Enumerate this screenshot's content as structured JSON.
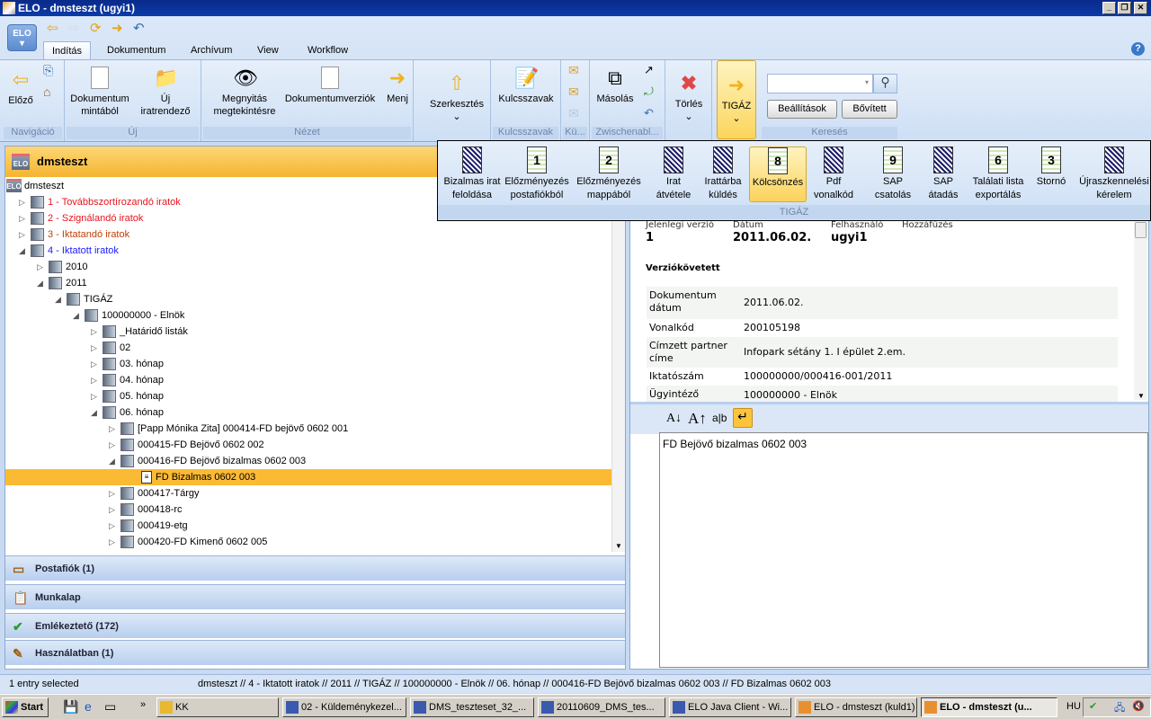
{
  "window": {
    "title": "ELO - dmsteszt (ugyi1)"
  },
  "app_menu": {
    "label": "ELO"
  },
  "tabs": [
    "Indítás",
    "Dokumentum",
    "Archívum",
    "View",
    "Workflow"
  ],
  "ribbon": {
    "groups": {
      "nav": "Navigáció",
      "new": "Új",
      "view": "Nézet",
      "keywords": "Kulcsszavak",
      "send": "Kü...",
      "clipboard": "Zwischenabl...",
      "search": "Keresés"
    },
    "buttons": {
      "prev": "Előző",
      "doc_template_1": "Dokumentum",
      "doc_template_2": "mintából",
      "new_folder_1": "Új",
      "new_folder_2": "iratrendező",
      "open_view_1": "Megnyitás",
      "open_view_2": "megtekintésre",
      "doc_versions": "Dokumentumverziók",
      "go": "Menj",
      "edit": "Szerkesztés",
      "keywords": "Kulcsszavak",
      "copy": "Másolás",
      "delete": "Törlés",
      "tigaz": "TIGÁZ"
    },
    "search": {
      "value": "",
      "settings": "Beállítások",
      "advanced": "Bővített"
    }
  },
  "tigaz_popup": {
    "group": "TIGÁZ",
    "items": [
      {
        "l1": "Bizalmas irat",
        "l2": "feloldása",
        "badge": ""
      },
      {
        "l1": "Előzményezés",
        "l2": "postafiókból",
        "badge": "1"
      },
      {
        "l1": "Előzményezés",
        "l2": "mappából",
        "badge": "2"
      },
      {
        "l1": "Irat",
        "l2": "átvétele",
        "badge": ""
      },
      {
        "l1": "Irattárba",
        "l2": "küldés",
        "badge": ""
      },
      {
        "l1": "Kölcsönzés",
        "l2": "",
        "badge": "8"
      },
      {
        "l1": "Pdf",
        "l2": "vonalkód",
        "badge": ""
      },
      {
        "l1": "SAP",
        "l2": "csatolás",
        "badge": "9"
      },
      {
        "l1": "SAP",
        "l2": "átadás",
        "badge": ""
      },
      {
        "l1": "Találati lista",
        "l2": "exportálás",
        "badge": "6"
      },
      {
        "l1": "Stornó",
        "l2": "",
        "badge": "3"
      },
      {
        "l1": "Újraszkennelési",
        "l2": "kérelem",
        "badge": ""
      }
    ]
  },
  "left_panel": {
    "title": "dmsteszt",
    "tree": [
      {
        "label": "dmsteszt",
        "level": 0,
        "state": "root",
        "color": "#000000"
      },
      {
        "label": "1 - Továbbszortírozandó iratok",
        "level": 1,
        "state": "collapsed",
        "color": "#e8141e"
      },
      {
        "label": "2 - Szignálandó iratok",
        "level": 1,
        "state": "collapsed",
        "color": "#e8141e"
      },
      {
        "label": "3 - Iktatandó iratok",
        "level": 1,
        "state": "collapsed",
        "color": "#c0400a"
      },
      {
        "label": "4 - Iktatott iratok",
        "level": 1,
        "state": "expanded",
        "color": "#1a1aff"
      },
      {
        "label": "2010",
        "level": 2,
        "state": "collapsed",
        "color": "#000000"
      },
      {
        "label": "2011",
        "level": 2,
        "state": "expanded",
        "color": "#000000"
      },
      {
        "label": "TIGÁZ",
        "level": 3,
        "state": "expanded",
        "color": "#000000"
      },
      {
        "label": "100000000 - Elnök",
        "level": 4,
        "state": "expanded",
        "color": "#000000"
      },
      {
        "label": "_Határidő listák",
        "level": 5,
        "state": "collapsed",
        "color": "#000000"
      },
      {
        "label": "02",
        "level": 5,
        "state": "collapsed",
        "color": "#000000"
      },
      {
        "label": "03. hónap",
        "level": 5,
        "state": "collapsed",
        "color": "#000000"
      },
      {
        "label": "04. hónap",
        "level": 5,
        "state": "collapsed",
        "color": "#000000"
      },
      {
        "label": "05. hónap",
        "level": 5,
        "state": "collapsed",
        "color": "#000000"
      },
      {
        "label": "06. hónap",
        "level": 5,
        "state": "expanded",
        "color": "#000000"
      },
      {
        "label": "[Papp Mónika Zita] 000414-FD bejövő 0602 001",
        "level": 6,
        "state": "collapsed",
        "color": "#000000"
      },
      {
        "label": "000415-FD Bejövő 0602 002",
        "level": 6,
        "state": "collapsed",
        "color": "#000000"
      },
      {
        "label": "000416-FD Bejövő bizalmas 0602 003",
        "level": 6,
        "state": "expanded",
        "color": "#000000"
      },
      {
        "label": "FD Bizalmas 0602 003",
        "level": 7,
        "state": "document",
        "color": "#000000",
        "selected": true
      },
      {
        "label": "000417-Tárgy",
        "level": 6,
        "state": "collapsed",
        "color": "#000000"
      },
      {
        "label": "000418-rc",
        "level": 6,
        "state": "collapsed",
        "color": "#000000"
      },
      {
        "label": "000419-etg",
        "level": 6,
        "state": "collapsed",
        "color": "#000000"
      },
      {
        "label": "000420-FD Kimenő 0602 005",
        "level": 6,
        "state": "collapsed",
        "color": "#000000"
      }
    ],
    "accordion": [
      {
        "label": "Postafiók  (1)",
        "icon": "inbox-icon"
      },
      {
        "label": "Munkalap",
        "icon": "clipboard-icon"
      },
      {
        "label": "Emlékeztető  (172)",
        "icon": "checkmark-icon"
      },
      {
        "label": "Használatban  (1)",
        "icon": "pencil-icon"
      }
    ]
  },
  "preview": {
    "headers": {
      "version": "Jelenlegi verzió",
      "date": "Dátum",
      "user": "Felhasználó",
      "comment": "Hozzáfűzés"
    },
    "values": {
      "version": "1",
      "date": "2011.06.02.",
      "user": "ugyi1"
    },
    "section": "Verziókövetett",
    "fields": [
      {
        "k": "Dokumentum dátum",
        "v": "2011.06.02."
      },
      {
        "k": "Vonalkód",
        "v": "200105198"
      },
      {
        "k": "Címzett partner címe",
        "v": "Infopark sétány 1. I épület 2.em."
      },
      {
        "k": "Iktatószám",
        "v": "100000000/000416-001/2011"
      },
      {
        "k": "Ügyintéző",
        "v": "100000000 - Elnök"
      }
    ],
    "text_tools": {
      "smaller": "A↓",
      "larger": "A↑",
      "wrap": "a|b"
    },
    "text": "FD Bejövő bizalmas 0602 003"
  },
  "status": {
    "selection": "1 entry selected",
    "path": "dmsteszt // 4 - Iktatott iratok // 2011 // TIGÁZ // 100000000 - Elnök // 06. hónap // 000416-FD Bejövő bizalmas 0602 003 // FD Bizalmas 0602 003"
  },
  "taskbar": {
    "start": "Start",
    "tasks": [
      "KK",
      "02 - Küldeménykezel...",
      "DMS_teszteset_32_...",
      "20110609_DMS_tes...",
      "ELO Java Client - Wi...",
      "ELO - dmsteszt (kuld1)",
      "ELO - dmsteszt (u..."
    ],
    "lang": "HU"
  },
  "colors": {
    "accent": "#fbba33",
    "titlebar": "#0a2a8a",
    "ribbon": "#dbe8f8"
  }
}
